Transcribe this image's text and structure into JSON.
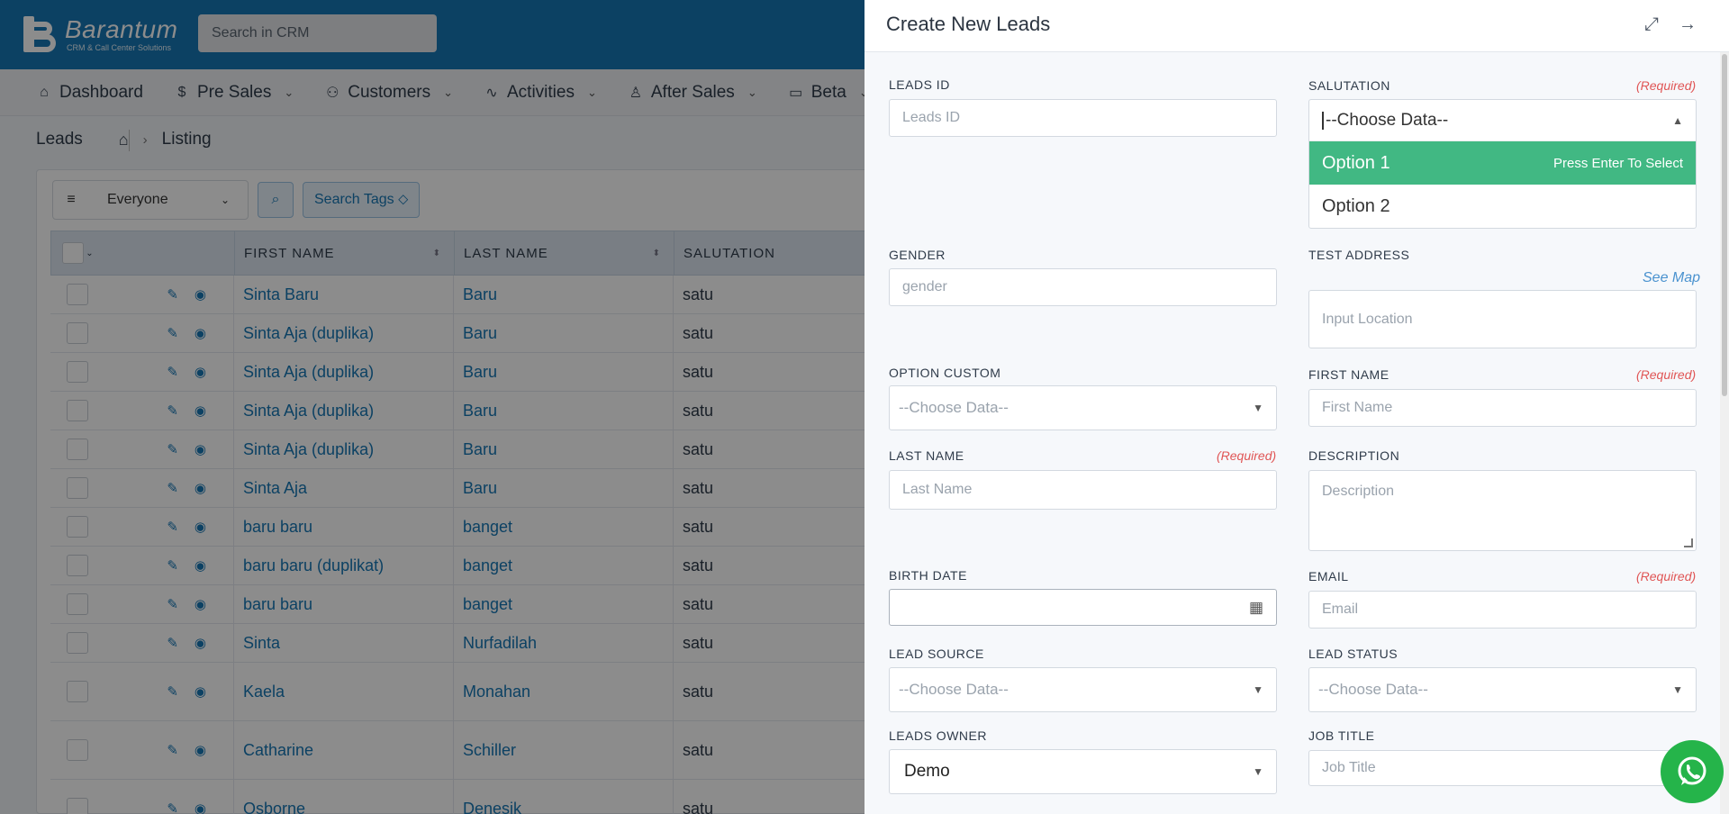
{
  "brand": {
    "name": "Barantum",
    "tagline": "CRM & Call Center Solutions"
  },
  "topbar": {
    "search_placeholder": "Search in CRM"
  },
  "nav": [
    {
      "label": "Dashboard",
      "icon": "home-icon"
    },
    {
      "label": "Pre Sales",
      "icon": "dollar-icon"
    },
    {
      "label": "Customers",
      "icon": "users-icon"
    },
    {
      "label": "Activities",
      "icon": "activity-icon"
    },
    {
      "label": "After Sales",
      "icon": "user-icon"
    },
    {
      "label": "Beta",
      "icon": "folder-icon"
    }
  ],
  "breadcrumb": {
    "module": "Leads",
    "page": "Listing"
  },
  "filters": {
    "owner": "Everyone",
    "search_tags": "Search Tags"
  },
  "table": {
    "columns": [
      "FIRST NAME",
      "LAST NAME",
      "SALUTATION"
    ],
    "rows": [
      [
        "Sinta Baru",
        "Baru",
        "satu"
      ],
      [
        "Sinta Aja (duplika)",
        "Baru",
        "satu"
      ],
      [
        "Sinta Aja (duplika)",
        "Baru",
        "satu"
      ],
      [
        "Sinta Aja (duplika)",
        "Baru",
        "satu"
      ],
      [
        "Sinta Aja (duplika)",
        "Baru",
        "satu"
      ],
      [
        "Sinta Aja",
        "Baru",
        "satu"
      ],
      [
        "baru baru",
        "banget",
        "satu"
      ],
      [
        "baru baru (duplikat)",
        "banget",
        "satu"
      ],
      [
        "baru baru",
        "banget",
        "satu"
      ],
      [
        "Sinta",
        "Nurfadilah",
        "satu"
      ],
      [
        "Kaela",
        "Monahan",
        "satu"
      ],
      [
        "Catharine",
        "Schiller",
        "satu"
      ],
      [
        "Osborne",
        "Denesik",
        "satu"
      ]
    ]
  },
  "panel": {
    "title": "Create New Leads",
    "required_text": "(Required)",
    "fields": {
      "leads_id": {
        "label": "LEADS ID",
        "placeholder": "Leads ID"
      },
      "salutation": {
        "label": "SALUTATION",
        "value": "--Choose Data--",
        "options": [
          "Option 1",
          "Option 2"
        ],
        "hint": "Press Enter To Select"
      },
      "gender": {
        "label": "GENDER",
        "placeholder": "gender"
      },
      "test_address": {
        "label": "TEST ADDRESS",
        "placeholder": "Input Location",
        "link": "See Map"
      },
      "option_custom": {
        "label": "OPTION CUSTOM",
        "value": "--Choose Data--"
      },
      "first_name": {
        "label": "FIRST NAME",
        "placeholder": "First Name"
      },
      "last_name": {
        "label": "LAST NAME",
        "placeholder": "Last Name"
      },
      "description": {
        "label": "DESCRIPTION",
        "placeholder": "Description"
      },
      "birth_date": {
        "label": "BIRTH DATE",
        "value": ""
      },
      "email": {
        "label": "EMAIL",
        "placeholder": "Email"
      },
      "lead_source": {
        "label": "LEAD SOURCE",
        "value": "--Choose Data--"
      },
      "lead_status": {
        "label": "LEAD STATUS",
        "value": "--Choose Data--"
      },
      "leads_owner": {
        "label": "LEADS OWNER",
        "value": "Demo"
      },
      "job_title": {
        "label": "JOB TITLE",
        "placeholder": "Job Title"
      }
    }
  },
  "colors": {
    "primary": "#1677b5",
    "highlight": "#41b883",
    "required": "#e05555",
    "whatsapp": "#25b44a"
  }
}
